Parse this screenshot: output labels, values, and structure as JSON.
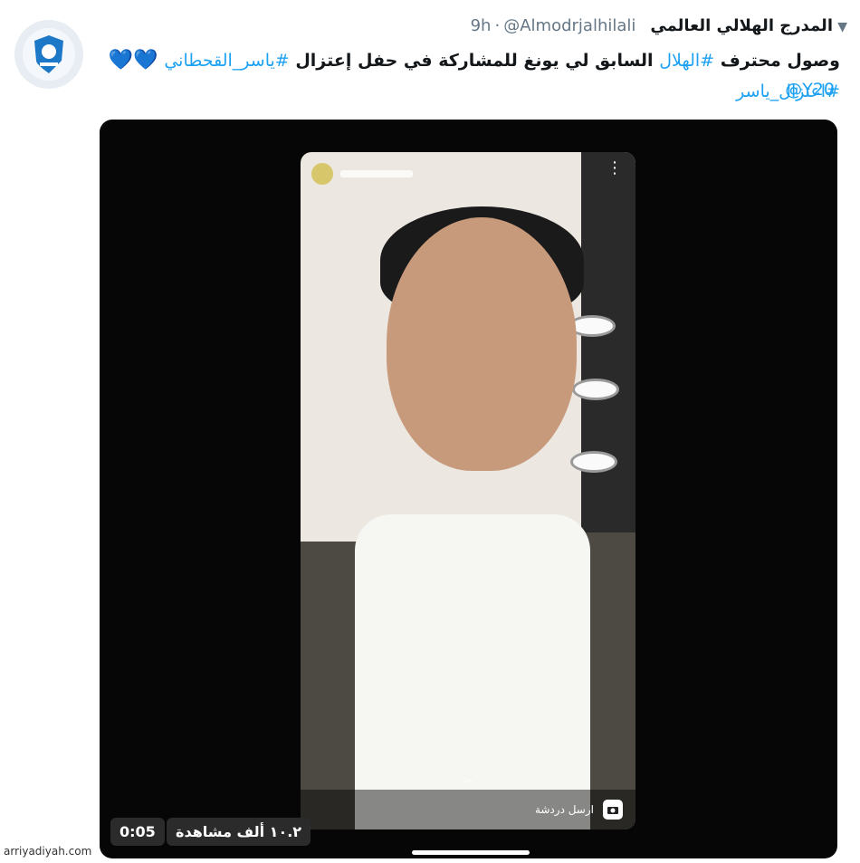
{
  "tweet": {
    "author_name": "المدرج الهلالي العالمي",
    "handle": "@Almodrjalhilali",
    "separator": "·",
    "time": "9h",
    "text_start": "وصول محترف",
    "tag_hilal": "#الهلال",
    "text_mid": "السابق لي يونغ للمشاركة في حفل إعتزال",
    "tag_yasser": "#ياسر_القحطاني",
    "tag_retire": "#اعتزال_ياسر",
    "mention": "@Y20",
    "hearts": "💙💙"
  },
  "video": {
    "views_badge": "١٠.٢ ألف مشاهدة",
    "duration": "0:05",
    "reply_label": "ارسل دردشة"
  },
  "credit": "arriyadiyah.com",
  "colors": {
    "link": "#1da1f2",
    "heart": "#7fdce8",
    "video_bg": "#060606"
  }
}
